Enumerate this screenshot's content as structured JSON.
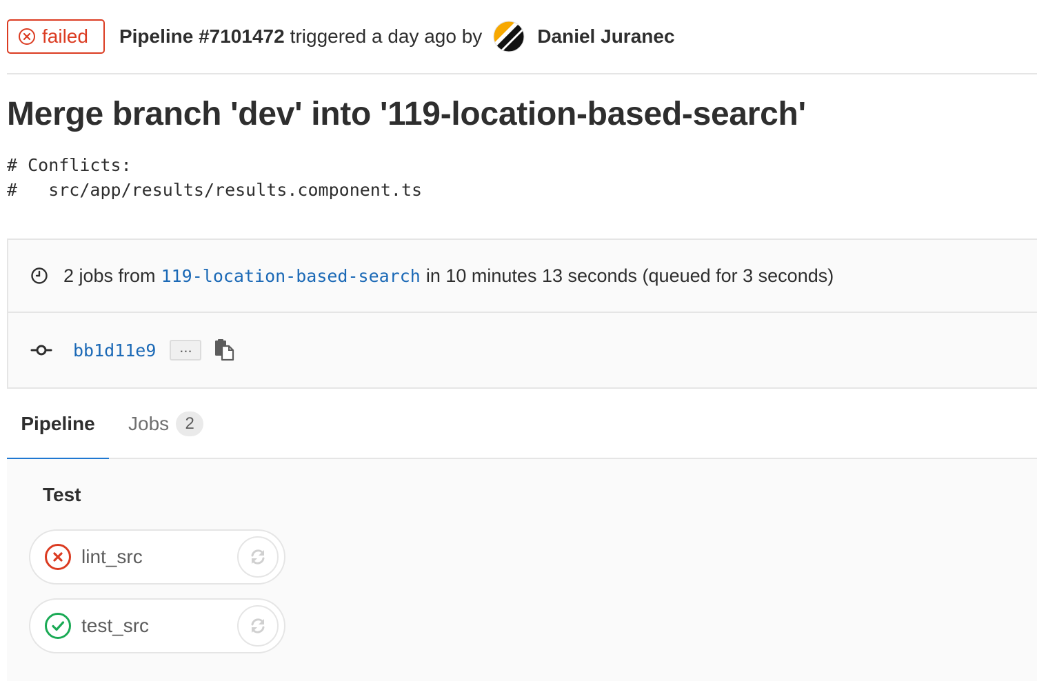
{
  "header": {
    "status_label": "failed",
    "pipeline_id": "Pipeline #7101472",
    "triggered_text": "triggered a day ago by",
    "author": "Daniel Juranec"
  },
  "commit": {
    "title": "Merge branch 'dev' into '119-location-based-search'",
    "description_lines": [
      "# Conflicts:",
      "#   src/app/results/results.component.ts"
    ]
  },
  "info": {
    "jobs_prefix": "2 jobs from",
    "branch": "119-location-based-search",
    "duration_text": "in 10 minutes 13 seconds (queued for 3 seconds)",
    "sha": "bb1d11e9",
    "expand_label": "..."
  },
  "tabs": [
    {
      "label": "Pipeline",
      "active": true
    },
    {
      "label": "Jobs",
      "count": "2",
      "active": false
    }
  ],
  "stage": {
    "title": "Test",
    "jobs": [
      {
        "name": "lint_src",
        "status": "failed"
      },
      {
        "name": "test_src",
        "status": "success"
      }
    ]
  },
  "colors": {
    "failed": "#db3b21",
    "success": "#1aaa55",
    "link": "#1b69b6",
    "active_tab": "#1f78d1"
  },
  "icons": [
    "failed-status-icon",
    "avatar",
    "clock-icon",
    "commit-icon",
    "clipboard-icon",
    "retry-icon",
    "success-status-icon"
  ]
}
